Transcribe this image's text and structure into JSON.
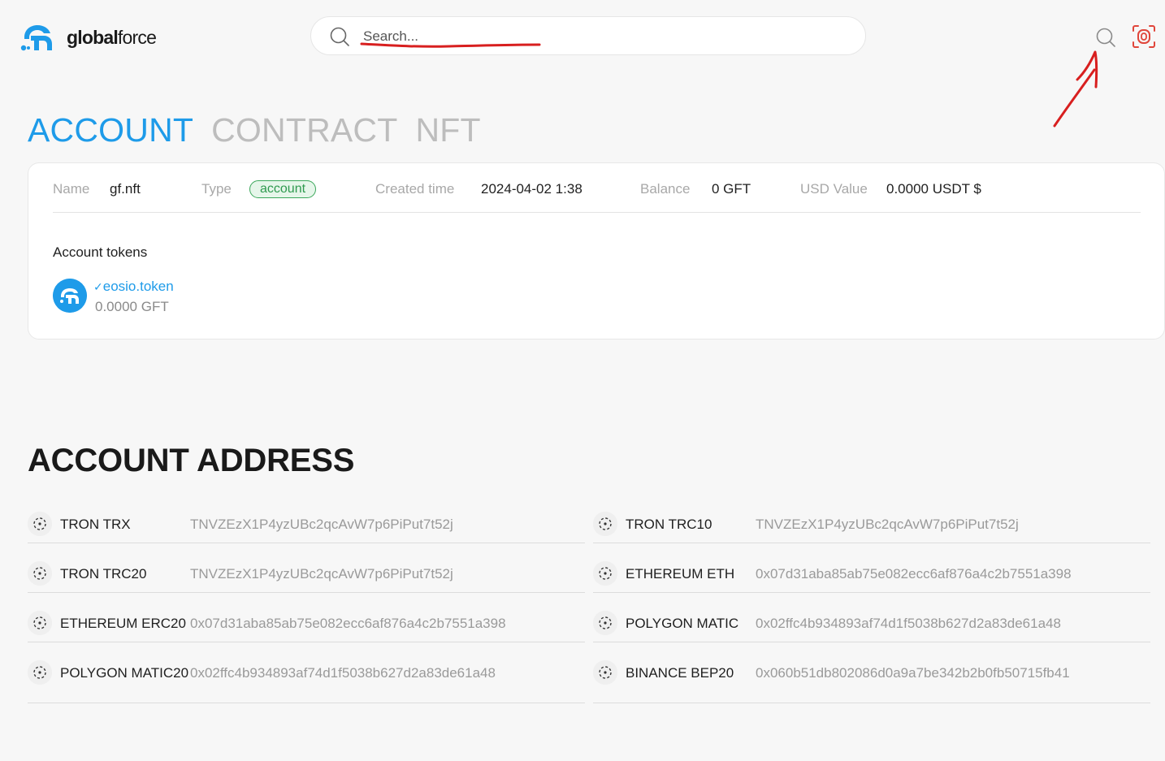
{
  "brand": {
    "name_bold": "global",
    "name_light": "force"
  },
  "search": {
    "placeholder": "Search..."
  },
  "tabs": [
    {
      "label": "ACCOUNT",
      "active": true
    },
    {
      "label": "CONTRACT",
      "active": false
    },
    {
      "label": "NFT",
      "active": false
    }
  ],
  "account": {
    "name_label": "Name",
    "name_value": "gf.nft",
    "type_label": "Type",
    "type_value": "account",
    "created_label": "Created time",
    "created_value": "2024-04-02 1:38",
    "balance_label": "Balance",
    "balance_value": "0 GFT",
    "usd_label": "USD Value",
    "usd_value": "0.0000 USDT $"
  },
  "tokens": {
    "title": "Account tokens",
    "items": [
      {
        "name": "eosio.token",
        "amount": "0.0000 GFT"
      }
    ]
  },
  "addresses": {
    "title": "ACCOUNT ADDRESS",
    "left": [
      {
        "chain": "TRON TRX",
        "hash": "TNVZEzX1P4yzUBc2qcAvW7p6PiPut7t52j"
      },
      {
        "chain": "TRON TRC20",
        "hash": "TNVZEzX1P4yzUBc2qcAvW7p6PiPut7t52j"
      },
      {
        "chain": "ETHEREUM ERC20",
        "hash": "0x07d31aba85ab75e082ecc6af876a4c2b7551a398"
      },
      {
        "chain": "POLYGON MATIC20",
        "hash": "0x02ffc4b934893af74d1f5038b627d2a83de61a48"
      }
    ],
    "right": [
      {
        "chain": "TRON TRC10",
        "hash": "TNVZEzX1P4yzUBc2qcAvW7p6PiPut7t52j"
      },
      {
        "chain": "ETHEREUM ETH",
        "hash": "0x07d31aba85ab75e082ecc6af876a4c2b7551a398"
      },
      {
        "chain": "POLYGON MATIC",
        "hash": "0x02ffc4b934893af74d1f5038b627d2a83de61a48"
      },
      {
        "chain": "BINANCE BEP20",
        "hash": "0x060b51db802086d0a9a7be342b2b0fb50715fb41"
      }
    ]
  },
  "colors": {
    "accent": "#1e9be9",
    "badge_green": "#2f9a4f",
    "annotation_red": "#d81f1f",
    "wallet_red": "#e0453a"
  },
  "icons": {
    "search": "search-icon",
    "wallet": "wallet-icon",
    "token": "globalforce-logo-icon",
    "chain": "chain-icon"
  }
}
